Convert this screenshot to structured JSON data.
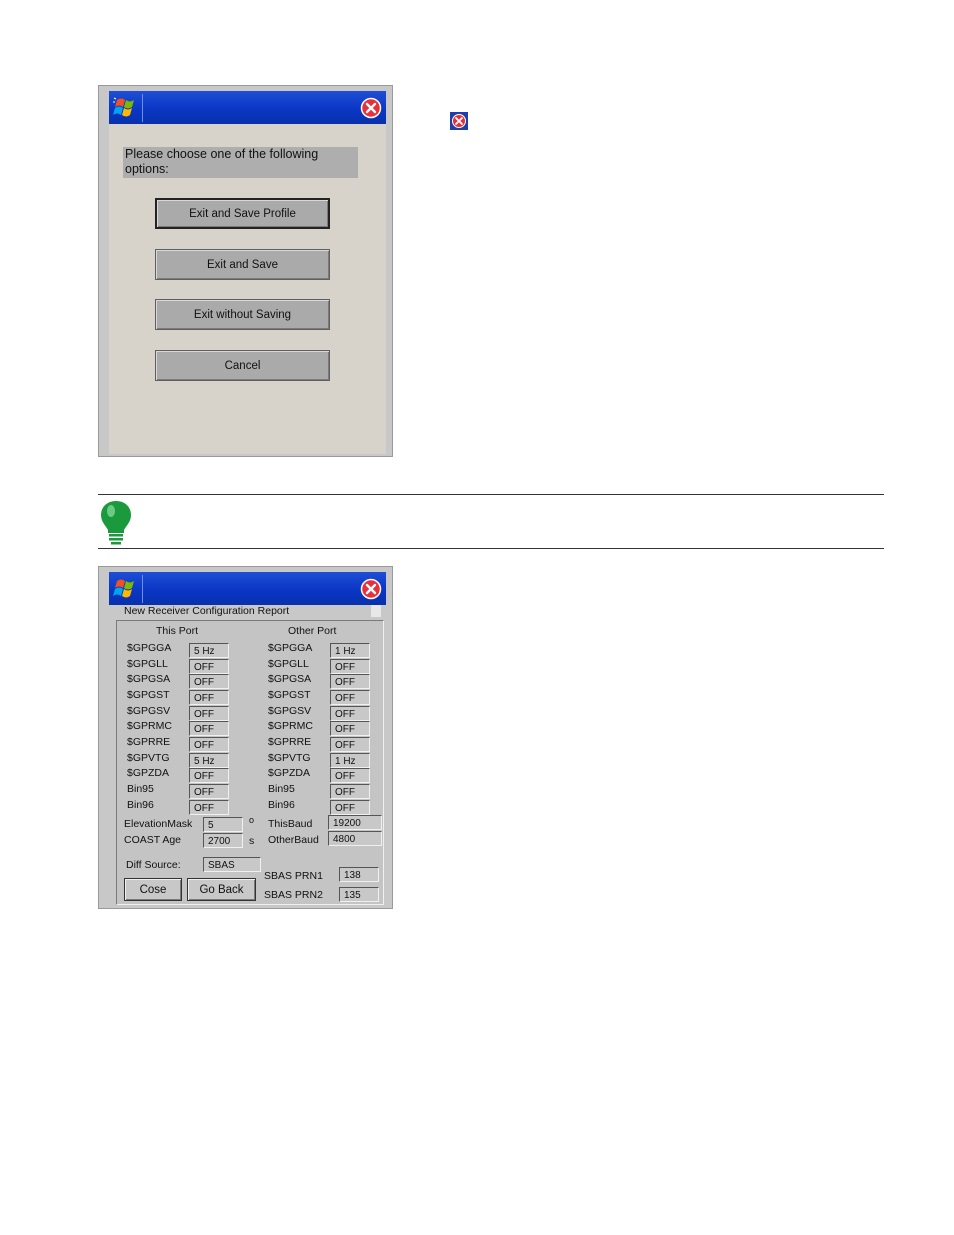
{
  "dialog1": {
    "prompt": "Please choose one of the following options:",
    "buttons": {
      "exit_save_profile": "Exit and Save Profile",
      "exit_save": "Exit and Save",
      "exit_no_save": "Exit without Saving",
      "cancel": "Cancel"
    }
  },
  "dialog2": {
    "tab_label": "New Receiver  Configuration Report",
    "this_port": {
      "heading": "This Port",
      "rows": [
        {
          "label": "$GPGGA",
          "value": "5 Hz"
        },
        {
          "label": "$GPGLL",
          "value": "OFF"
        },
        {
          "label": "$GPGSA",
          "value": "OFF"
        },
        {
          "label": "$GPGST",
          "value": "OFF"
        },
        {
          "label": "$GPGSV",
          "value": "OFF"
        },
        {
          "label": "$GPRMC",
          "value": "OFF"
        },
        {
          "label": "$GPRRE",
          "value": "OFF"
        },
        {
          "label": "$GPVTG",
          "value": "5 Hz"
        },
        {
          "label": "$GPZDA",
          "value": "OFF"
        },
        {
          "label": "Bin95",
          "value": "OFF"
        },
        {
          "label": "Bin96",
          "value": "OFF"
        }
      ]
    },
    "other_port": {
      "heading": "Other Port",
      "rows": [
        {
          "label": "$GPGGA",
          "value": "1 Hz"
        },
        {
          "label": "$GPGLL",
          "value": "OFF"
        },
        {
          "label": "$GPGSA",
          "value": "OFF"
        },
        {
          "label": "$GPGST",
          "value": "OFF"
        },
        {
          "label": "$GPGSV",
          "value": "OFF"
        },
        {
          "label": "$GPRMC",
          "value": "OFF"
        },
        {
          "label": "$GPRRE",
          "value": "OFF"
        },
        {
          "label": "$GPVTG",
          "value": "1 Hz"
        },
        {
          "label": "$GPZDA",
          "value": "OFF"
        },
        {
          "label": "Bin95",
          "value": "OFF"
        },
        {
          "label": "Bin96",
          "value": "OFF"
        }
      ]
    },
    "elevation_mask": {
      "label": "ElevationMask",
      "value": "5",
      "unit": "o"
    },
    "coast_age": {
      "label": "COAST Age",
      "value": "2700",
      "unit": "s"
    },
    "this_baud": {
      "label": "ThisBaud",
      "value": "19200"
    },
    "other_baud": {
      "label": "OtherBaud",
      "value": "4800"
    },
    "diff_source": {
      "label": "Diff Source:",
      "value": "SBAS"
    },
    "sbas_prn1": {
      "label": "SBAS PRN1",
      "value": "138"
    },
    "sbas_prn2": {
      "label": "SBAS PRN2",
      "value": "135"
    },
    "buttons": {
      "close": "Cose",
      "go_back": "Go Back"
    }
  }
}
